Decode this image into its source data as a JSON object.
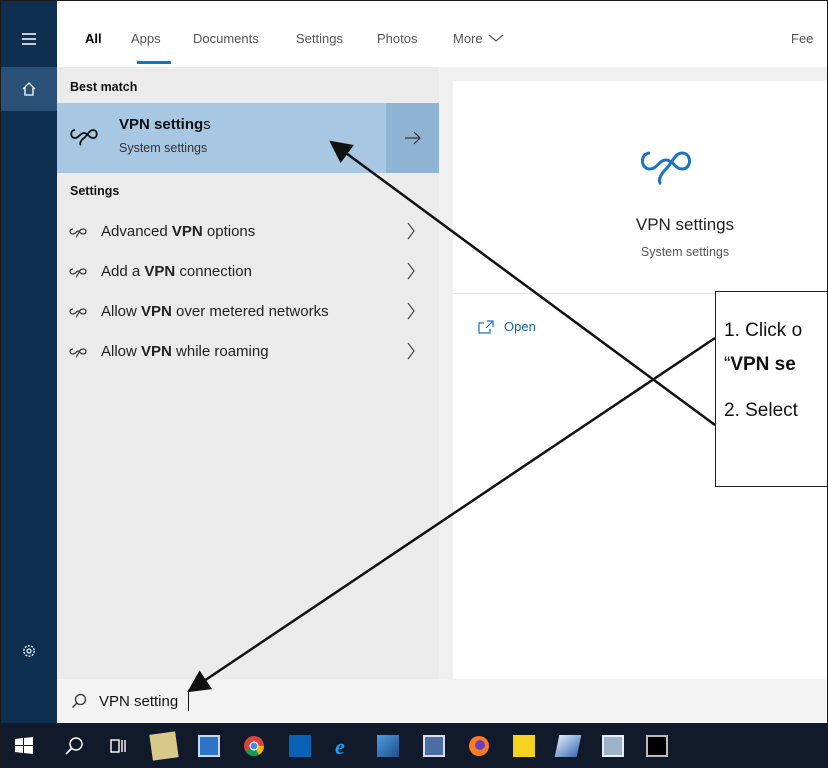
{
  "tabs": [
    {
      "label": "All",
      "active": true
    },
    {
      "label": "Apps"
    },
    {
      "label": "Documents"
    },
    {
      "label": "Settings"
    },
    {
      "label": "Photos"
    },
    {
      "label": "More"
    },
    {
      "label": "Fee"
    }
  ],
  "results": {
    "best_match_header": "Best match",
    "best_match": {
      "title": "VPN setting",
      "title_suffix": "s",
      "subtitle": "System settings"
    },
    "settings_header": "Settings",
    "items": [
      {
        "pre": "Advanced ",
        "bold": "VPN",
        "post": " options"
      },
      {
        "pre": "Add a ",
        "bold": "VPN",
        "post": " connection"
      },
      {
        "pre": "Allow ",
        "bold": "VPN",
        "post": " over metered networks"
      },
      {
        "pre": "Allow ",
        "bold": "VPN",
        "post": " while roaming"
      }
    ]
  },
  "preview": {
    "title": "VPN settings",
    "subtitle": "System settings",
    "open_label": "Open"
  },
  "search": {
    "value": "VPN setting"
  },
  "callout": {
    "line1": "1. Click o",
    "line2_pre": "“",
    "line2_bold": "VPN se",
    "line3": "2. Select"
  },
  "colors": {
    "rail": "#0e2f4f",
    "accent": "#0078d7",
    "highlight": "#a7c7e2",
    "taskbar": "#111a2b"
  },
  "icons": {
    "rail": [
      "hamburger-menu-icon",
      "home-icon",
      "gear-icon"
    ],
    "taskbar": [
      "windows-start-icon",
      "search-icon",
      "task-view-icon",
      "notepad-icon",
      "control-panel-icon",
      "chrome-icon",
      "outlook-icon",
      "internet-explorer-icon",
      "network-icon",
      "presentation-icon",
      "firefox-icon",
      "sticky-notes-icon",
      "paint-icon",
      "remote-desktop-icon",
      "command-prompt-icon"
    ]
  }
}
